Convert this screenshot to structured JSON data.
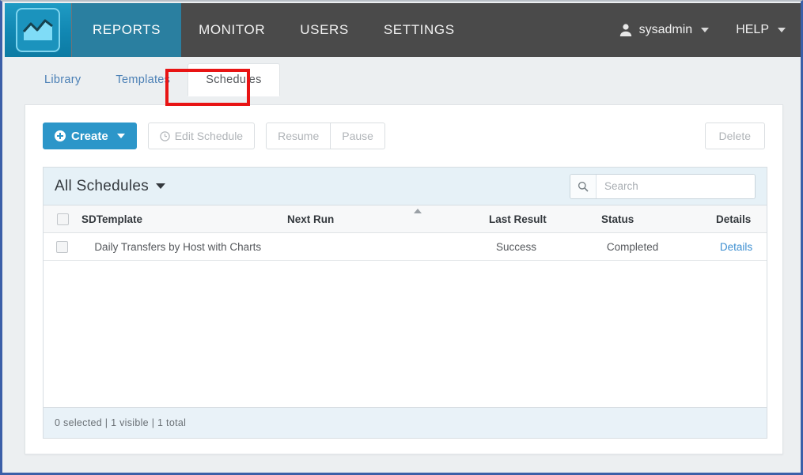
{
  "topbar": {
    "logo_icon": "chart-logo-icon",
    "nav": [
      {
        "label": "REPORTS",
        "active": true
      },
      {
        "label": "MONITOR",
        "active": false
      },
      {
        "label": "USERS",
        "active": false
      },
      {
        "label": "SETTINGS",
        "active": false
      }
    ],
    "user": {
      "icon": "user-icon",
      "label": "sysadmin"
    },
    "help": {
      "label": "HELP"
    },
    "bg_color": "#4a4a4a",
    "active_color": "#2a7fa0"
  },
  "subtabs": [
    {
      "label": "Library",
      "active": false
    },
    {
      "label": "Templates",
      "active": false
    },
    {
      "label": "Schedules",
      "active": true
    }
  ],
  "annotation": {
    "target": "Schedules",
    "color": "#e81414"
  },
  "toolbar": {
    "create_label": "Create",
    "edit_schedule_label": "Edit Schedule",
    "resume_label": "Resume",
    "pause_label": "Pause",
    "delete_label": "Delete"
  },
  "panel": {
    "title": "All Schedules",
    "search_placeholder": "Search",
    "search_value": "",
    "search_icon": "search-icon"
  },
  "table": {
    "columns": [
      "SDTemplate",
      "Next Run",
      "Last Result",
      "Status",
      "Details"
    ],
    "sort_column": "Next Run",
    "sort_direction": "ascending",
    "rows": [
      {
        "checked": false,
        "sdtemplate": "Daily Transfers by Host with Charts",
        "next_run": "",
        "last_result": "Success",
        "status": "Completed",
        "details": "Details"
      }
    ]
  },
  "footer": {
    "status": "0 selected | 1 visible | 1 total"
  }
}
